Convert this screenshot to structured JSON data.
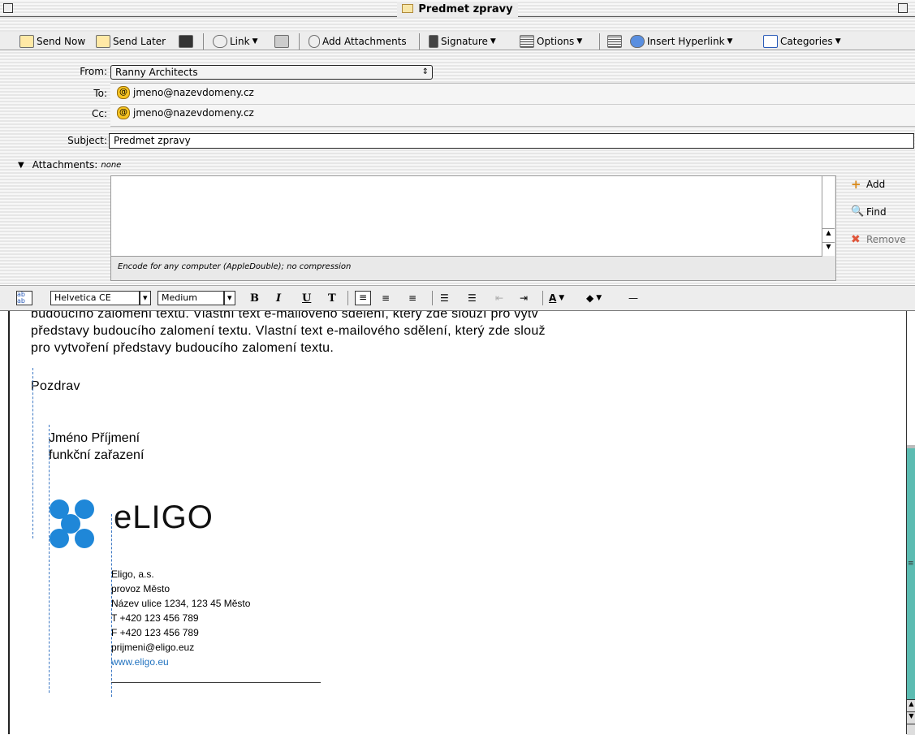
{
  "window": {
    "title": "Predmet zpravy"
  },
  "toolbar": {
    "send_now": "Send Now",
    "send_later": "Send Later",
    "link": "Link",
    "add_attachments": "Add Attachments",
    "signature": "Signature",
    "options": "Options",
    "insert_hyperlink": "Insert Hyperlink",
    "categories": "Categories"
  },
  "header": {
    "from_label": "From:",
    "from_value": "Ranny Architects",
    "to_label": "To:",
    "to_value": "jmeno@nazevdomeny.cz",
    "cc_label": "Cc:",
    "cc_value": "jmeno@nazevdomeny.cz",
    "subject_label": "Subject:",
    "subject_value": "Predmet zpravy",
    "attachments_label": "Attachments:",
    "attachments_value": "none"
  },
  "attachments": {
    "encode_text": "Encode for any computer (AppleDouble); no compression",
    "add": "Add",
    "find": "Find",
    "remove": "Remove"
  },
  "format": {
    "font": "Helvetica CE",
    "size": "Medium",
    "bold": "B",
    "italic": "I",
    "underline": "U",
    "teletype": "T"
  },
  "message": {
    "line1": "budoucího zalomení textu. Vlastní text e-mailového sdělení, který zde slouží pro vytv",
    "line2": "představy budoucího zalomení textu. Vlastní text e-mailového sdělení, který zde slouž",
    "line3": "pro vytvoření představy budoucího zalomení textu.",
    "greeting": "Pozdrav",
    "name": "Jméno  Příjmení",
    "position": "funkční zařazení",
    "logo_text": "eLIGO",
    "company_name": "Eligo, a.s.",
    "company_branch": "provoz  Město",
    "company_address": "Název  ulice  1234,  123  45  Město",
    "phone": "T  +420  123  456  789",
    "fax": "F  +420  123  456  789",
    "email": "prijmeni@eligo.euz",
    "web": "www.eligo.eu"
  },
  "colors": {
    "logo_blue": "#1f87d8",
    "link_blue": "#2273c0",
    "scroll_teal": "#5cbcb2"
  }
}
